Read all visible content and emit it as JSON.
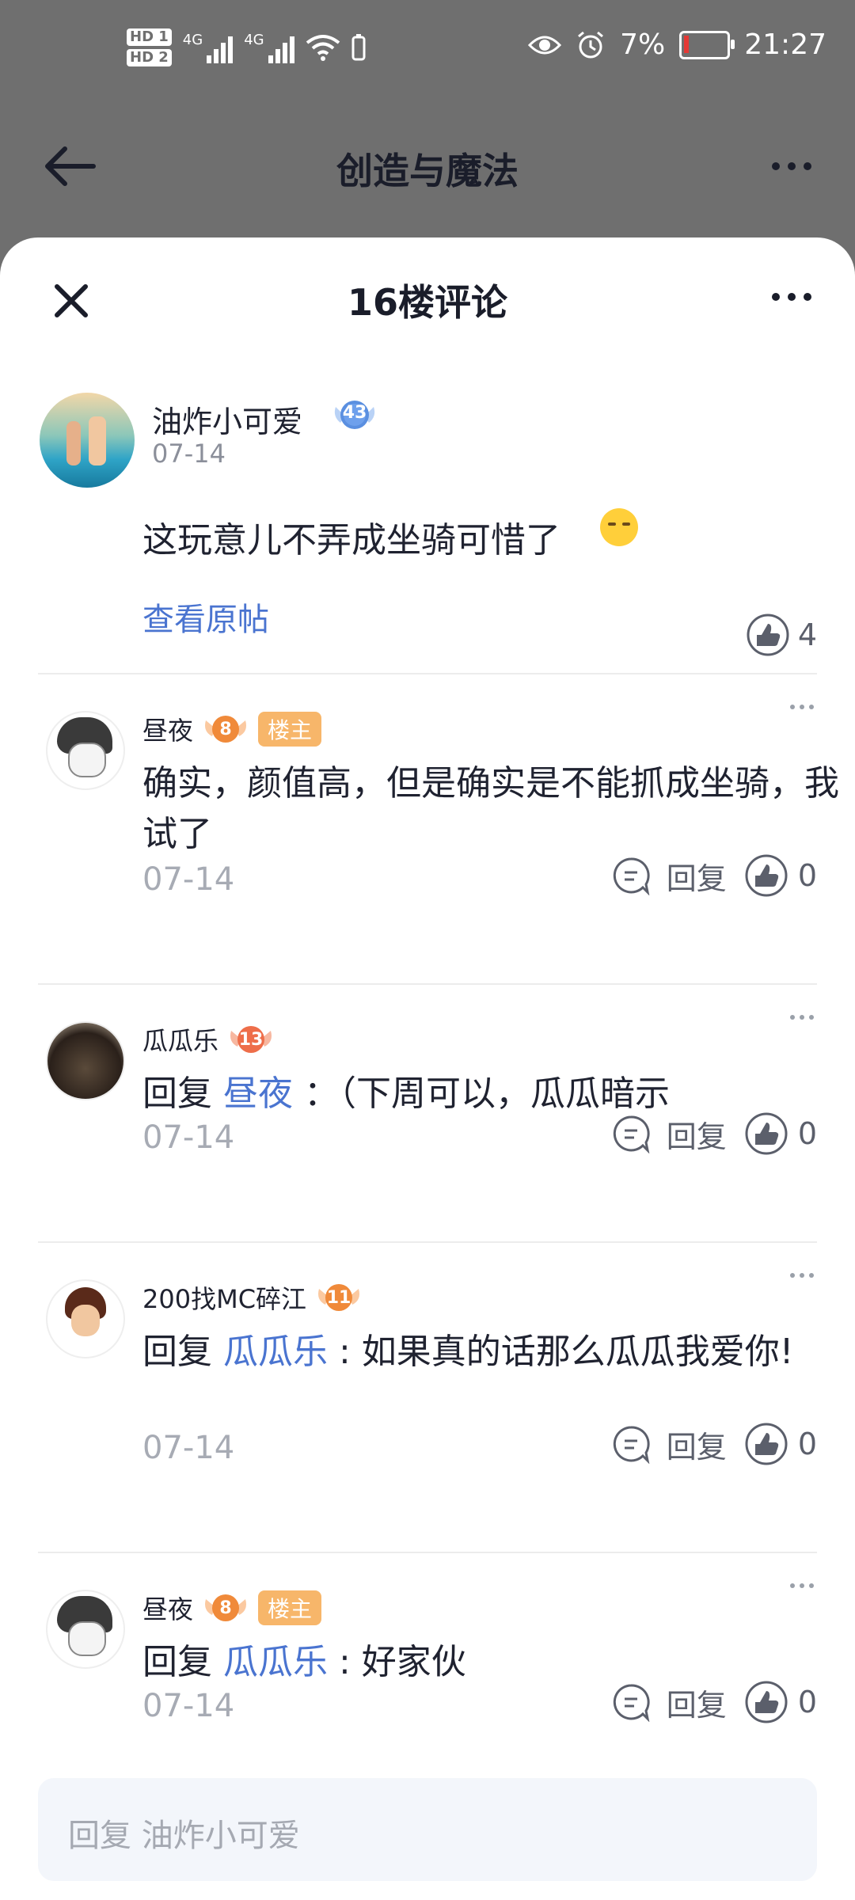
{
  "status_bar": {
    "network_left": "4G",
    "network_right": "4G",
    "hd1": "HD 1",
    "hd2": "HD 2",
    "battery_text": "7%",
    "time": "21:27"
  },
  "header": {
    "title": "创造与魔法"
  },
  "sheet": {
    "title": "16楼评论"
  },
  "post": {
    "author": "油炸小可爱",
    "level": "43",
    "date": "07-14",
    "content": "这玩意儿不弄成坐骑可惜了",
    "view_original": "查看原帖",
    "likes": "4"
  },
  "comments": [
    {
      "author": "昼夜",
      "level": "8",
      "op_tag": "楼主",
      "text": "确实，颜值高，但是确实是不能抓成坐骑，我试了",
      "date": "07-14",
      "reply_label": "回复",
      "likes": "0"
    },
    {
      "author": "瓜瓜乐",
      "level": "13",
      "reply_prefix": "回复",
      "mention": "昼夜",
      "text": "：（下周可以，瓜瓜暗示",
      "date": "07-14",
      "reply_label": "回复",
      "likes": "0"
    },
    {
      "author": "200找MC碎江",
      "level": "11",
      "reply_prefix": "回复",
      "mention": "瓜瓜乐",
      "text": ": 如果真的话那么瓜瓜我爱你!",
      "date": "07-14",
      "reply_label": "回复",
      "likes": "0"
    },
    {
      "author": "昼夜",
      "level": "8",
      "op_tag": "楼主",
      "reply_prefix": "回复",
      "mention": "瓜瓜乐",
      "text": ": 好家伙",
      "date": "07-14",
      "reply_label": "回复",
      "likes": "0"
    }
  ],
  "input": {
    "placeholder": "回复 油炸小可爱"
  },
  "colors": {
    "accent": "#4a74d0",
    "op_tag": "#f7b66a",
    "level_badge_orange": "#f08a3a",
    "level_badge_blue": "#5a8fe0",
    "overlay": "#6f6f6f"
  }
}
